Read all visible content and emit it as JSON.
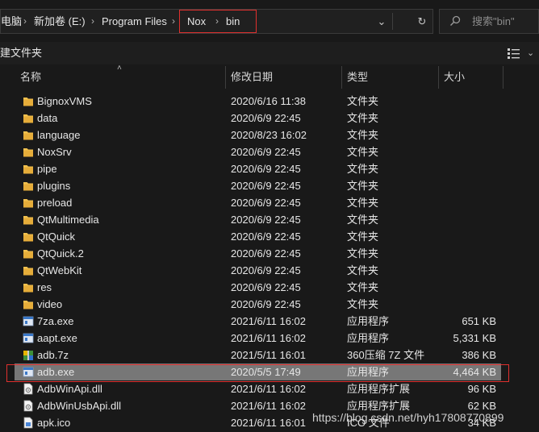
{
  "address_bar": {
    "breadcrumbs": [
      "电脑",
      "新加卷 (E:)",
      "Program Files",
      "Nox",
      "bin"
    ],
    "separator": "›",
    "dropdown_glyph": "⌄",
    "refresh_glyph": "↻"
  },
  "search": {
    "placeholder": "搜索\"bin\""
  },
  "toolbar": {
    "new_folder": "建文件夹",
    "chevron": "⌄"
  },
  "columns": {
    "name": "名称",
    "date": "修改日期",
    "type": "类型",
    "size": "大小",
    "sort_arrow": "˄"
  },
  "colors": {
    "folder": "#f2c14e",
    "highlight": "#e0302e",
    "selected_row": "#777777"
  },
  "files": [
    {
      "name": "BignoxVMS",
      "date": "2020/6/16 11:38",
      "type": "文件夹",
      "size": "",
      "icon": "folder-icon"
    },
    {
      "name": "data",
      "date": "2020/6/9 22:45",
      "type": "文件夹",
      "size": "",
      "icon": "folder-icon"
    },
    {
      "name": "language",
      "date": "2020/8/23 16:02",
      "type": "文件夹",
      "size": "",
      "icon": "folder-icon"
    },
    {
      "name": "NoxSrv",
      "date": "2020/6/9 22:45",
      "type": "文件夹",
      "size": "",
      "icon": "folder-icon"
    },
    {
      "name": "pipe",
      "date": "2020/6/9 22:45",
      "type": "文件夹",
      "size": "",
      "icon": "folder-icon"
    },
    {
      "name": "plugins",
      "date": "2020/6/9 22:45",
      "type": "文件夹",
      "size": "",
      "icon": "folder-icon"
    },
    {
      "name": "preload",
      "date": "2020/6/9 22:45",
      "type": "文件夹",
      "size": "",
      "icon": "folder-icon"
    },
    {
      "name": "QtMultimedia",
      "date": "2020/6/9 22:45",
      "type": "文件夹",
      "size": "",
      "icon": "folder-icon"
    },
    {
      "name": "QtQuick",
      "date": "2020/6/9 22:45",
      "type": "文件夹",
      "size": "",
      "icon": "folder-icon"
    },
    {
      "name": "QtQuick.2",
      "date": "2020/6/9 22:45",
      "type": "文件夹",
      "size": "",
      "icon": "folder-icon"
    },
    {
      "name": "QtWebKit",
      "date": "2020/6/9 22:45",
      "type": "文件夹",
      "size": "",
      "icon": "folder-icon"
    },
    {
      "name": "res",
      "date": "2020/6/9 22:45",
      "type": "文件夹",
      "size": "",
      "icon": "folder-icon"
    },
    {
      "name": "video",
      "date": "2020/6/9 22:45",
      "type": "文件夹",
      "size": "",
      "icon": "folder-icon"
    },
    {
      "name": "7za.exe",
      "date": "2021/6/11 16:02",
      "type": "应用程序",
      "size": "651 KB",
      "icon": "exe-icon"
    },
    {
      "name": "aapt.exe",
      "date": "2021/6/11 16:02",
      "type": "应用程序",
      "size": "5,331 KB",
      "icon": "exe-icon"
    },
    {
      "name": "adb.7z",
      "date": "2021/5/11 16:01",
      "type": "360压缩 7Z 文件",
      "size": "386 KB",
      "icon": "archive-icon"
    },
    {
      "name": "adb.exe",
      "date": "2020/5/5 17:49",
      "type": "应用程序",
      "size": "4,464 KB",
      "icon": "exe-icon",
      "selected": true
    },
    {
      "name": "AdbWinApi.dll",
      "date": "2021/6/11 16:02",
      "type": "应用程序扩展",
      "size": "96 KB",
      "icon": "dll-icon"
    },
    {
      "name": "AdbWinUsbApi.dll",
      "date": "2021/6/11 16:02",
      "type": "应用程序扩展",
      "size": "62 KB",
      "icon": "dll-icon"
    },
    {
      "name": "apk.ico",
      "date": "2021/6/11 16:01",
      "type": "ICO 文件",
      "size": "34 KB",
      "icon": "ico-icon"
    }
  ],
  "watermark": "https://blog.csdn.net/hyh17808770899"
}
